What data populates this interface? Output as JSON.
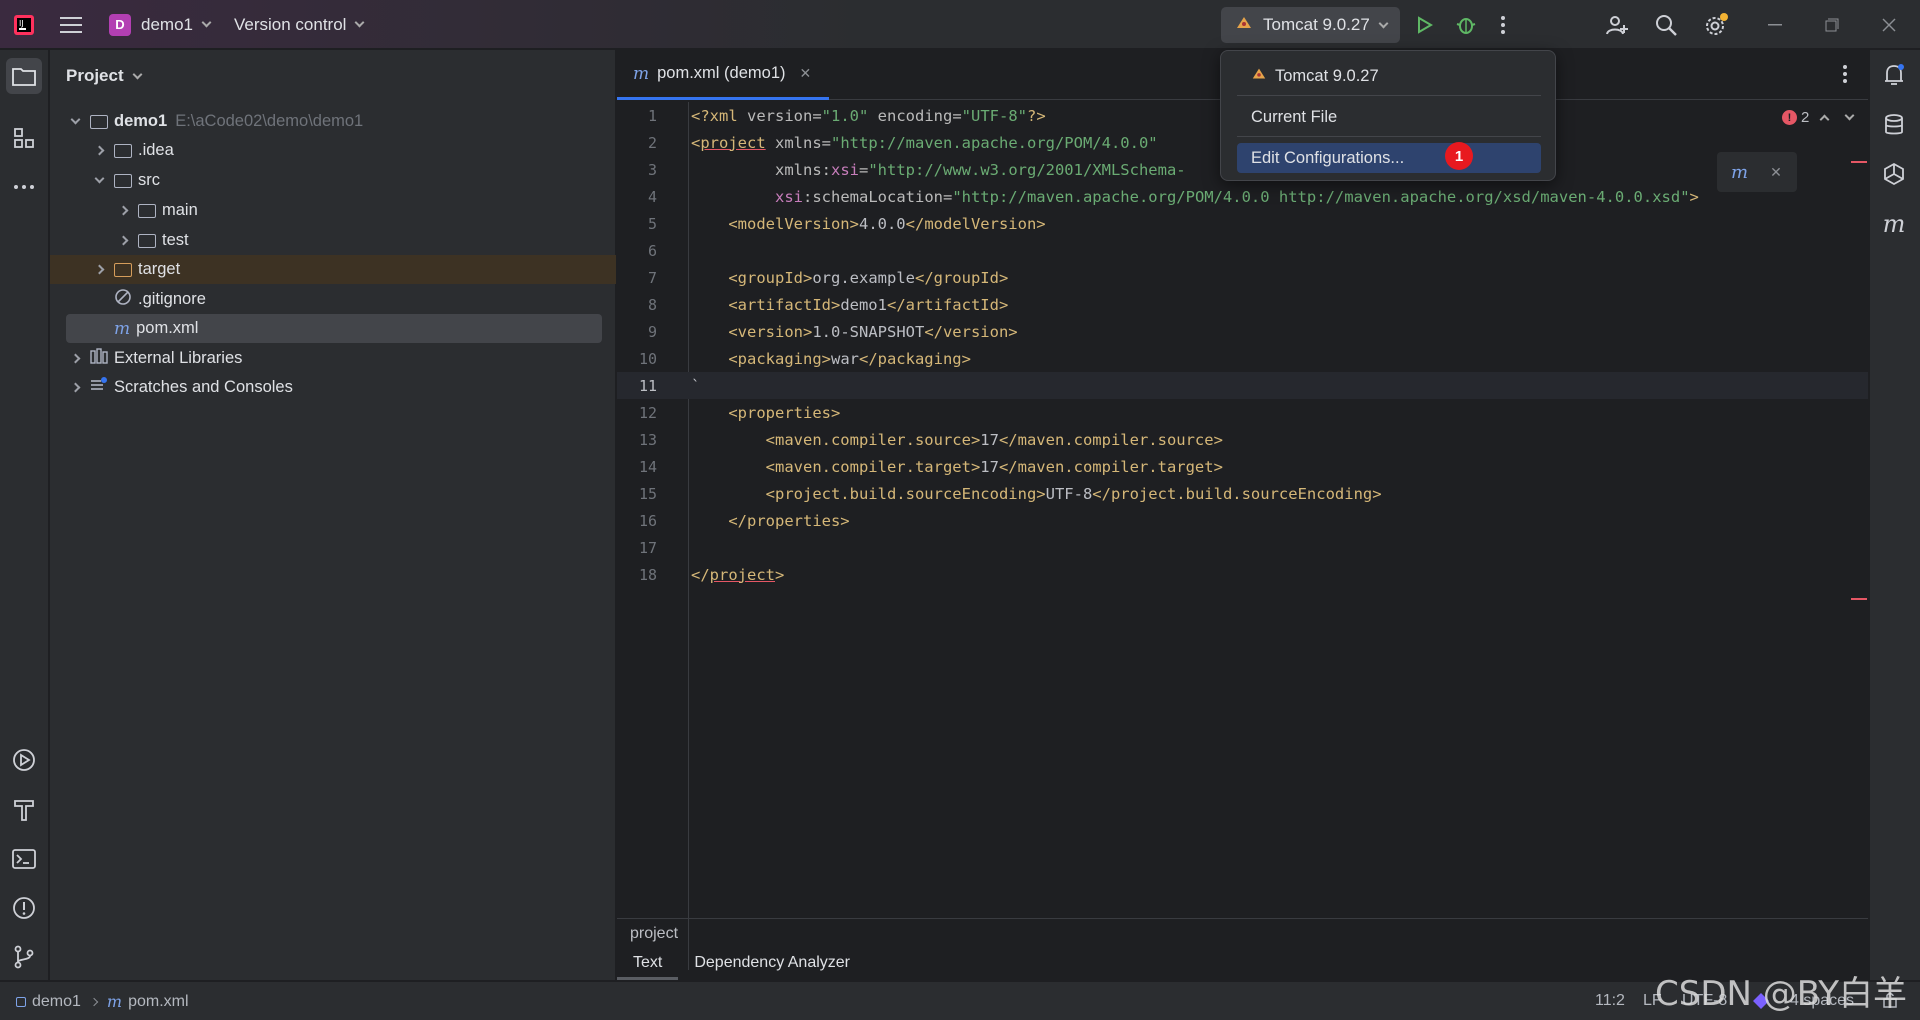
{
  "titlebar": {
    "project_badge": "D",
    "project_name": "demo1",
    "version_control": "Version control",
    "run_config": "Tomcat 9.0.27"
  },
  "project_panel": {
    "title": "Project",
    "root_name": "demo1",
    "root_path": "E:\\aCode02\\demo\\demo1",
    "items": [
      {
        "label": "demo1"
      },
      {
        "label": ".idea"
      },
      {
        "label": "src"
      },
      {
        "label": "main"
      },
      {
        "label": "test"
      },
      {
        "label": "target"
      },
      {
        "label": ".gitignore"
      },
      {
        "label": "pom.xml"
      },
      {
        "label": "External Libraries"
      },
      {
        "label": "Scratches and Consoles"
      }
    ]
  },
  "editor": {
    "tab_label": "pom.xml (demo1)",
    "error_count": "2",
    "breadcrumb": "project",
    "bottom_tabs": [
      "Text",
      "Dependency Analyzer"
    ],
    "line_numbers": [
      "1",
      "2",
      "3",
      "4",
      "5",
      "6",
      "7",
      "8",
      "9",
      "10",
      "11",
      "12",
      "13",
      "14",
      "15",
      "16",
      "17",
      "18"
    ]
  },
  "dropdown": {
    "items": [
      "Tomcat 9.0.27",
      "Current File",
      "Edit Configurations..."
    ],
    "step_badge": "1"
  },
  "statusbar": {
    "crumb_project": "demo1",
    "crumb_file": "pom.xml",
    "position": "11:2",
    "line_sep": "LF",
    "encoding": "UTF-8",
    "indent": "4 spaces"
  },
  "watermark": "CSDN @BY白羊",
  "colors": {
    "accent": "#3574f0",
    "selection": "#2e436e",
    "badge_red": "#e8191f",
    "run_green": "#5fb865"
  }
}
